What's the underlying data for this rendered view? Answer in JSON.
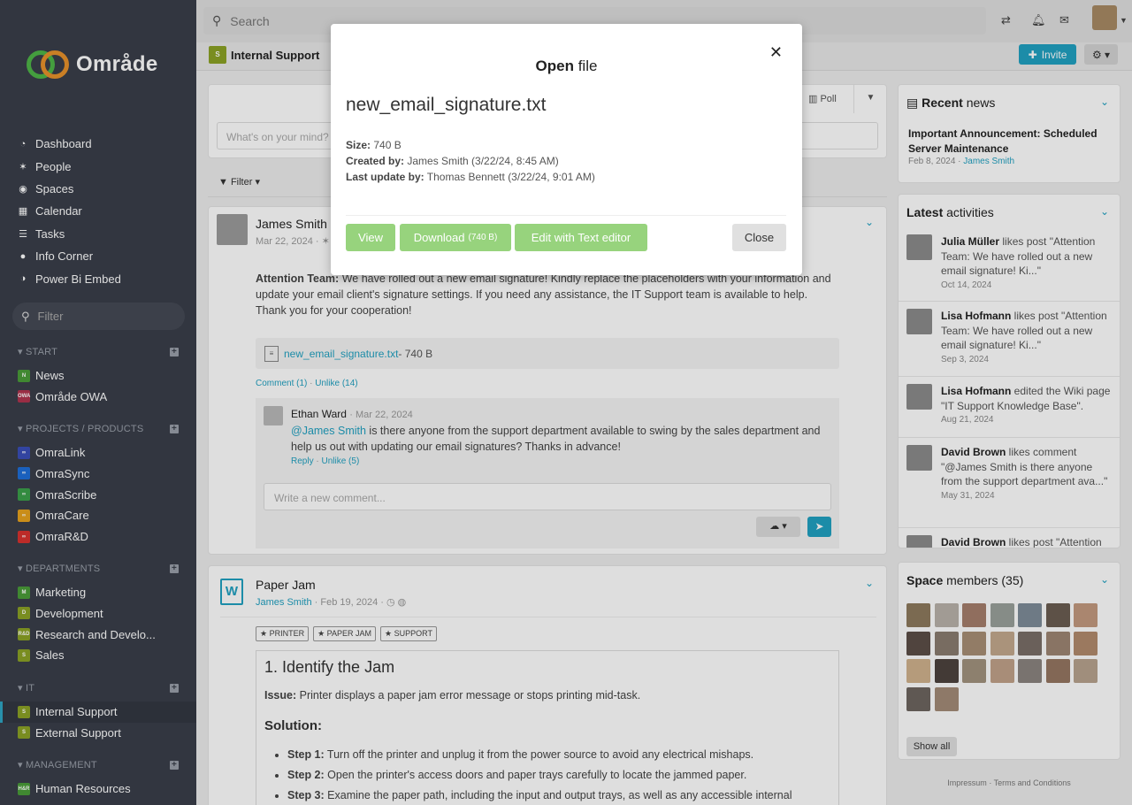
{
  "brand": {
    "name": "Område",
    "ring_green": "#4fb648",
    "ring_orange": "#e8922b"
  },
  "nav": [
    {
      "icon": "dashboard-icon",
      "glyph": "◔",
      "label": "Dashboard"
    },
    {
      "icon": "people-icon",
      "glyph": "✶",
      "label": "People"
    },
    {
      "icon": "spaces-icon",
      "glyph": "◉",
      "label": "Spaces"
    },
    {
      "icon": "calendar-icon",
      "glyph": "▦",
      "label": "Calendar"
    },
    {
      "icon": "tasks-icon",
      "glyph": "☰",
      "label": "Tasks"
    },
    {
      "icon": "info-corner-icon",
      "glyph": "●",
      "label": "Info Corner"
    },
    {
      "icon": "power-bi-icon",
      "glyph": "◑",
      "label": "Power Bi Embed"
    }
  ],
  "sidebar_filter": {
    "placeholder": "Filter"
  },
  "sections": [
    {
      "title": "START",
      "items": [
        {
          "label": "News",
          "abbr": "N",
          "color": "#4a9d39"
        },
        {
          "label": "Område OWA",
          "abbr": "OWA",
          "color": "#b0344f"
        }
      ]
    },
    {
      "title": "PROJECTS / PRODUCTS",
      "items": [
        {
          "label": "OmraLink",
          "abbr": "∞",
          "color": "#3a4fb8"
        },
        {
          "label": "OmraSync",
          "abbr": "∞",
          "color": "#1e6fd9"
        },
        {
          "label": "OmraScribe",
          "abbr": "∞",
          "color": "#3ba04a"
        },
        {
          "label": "OmraCare",
          "abbr": "∞",
          "color": "#e7a21d"
        },
        {
          "label": "OmraR&D",
          "abbr": "∞",
          "color": "#d8322e"
        }
      ]
    },
    {
      "title": "DEPARTMENTS",
      "items": [
        {
          "label": "Marketing",
          "abbr": "M",
          "color": "#4a9d39"
        },
        {
          "label": "Development",
          "abbr": "D",
          "color": "#8ba225"
        },
        {
          "label": "Research and Develo...",
          "abbr": "R&D",
          "color": "#8ba225"
        },
        {
          "label": "Sales",
          "abbr": "S",
          "color": "#8ba225"
        }
      ]
    },
    {
      "title": "IT",
      "items": [
        {
          "label": "Internal Support",
          "abbr": "S",
          "color": "#8ba225",
          "active": true
        },
        {
          "label": "External Support",
          "abbr": "S",
          "color": "#8ba225"
        }
      ]
    },
    {
      "title": "MANAGEMENT",
      "items": [
        {
          "label": "Human Resources",
          "abbr": "H&R",
          "color": "#4a9d39"
        }
      ]
    }
  ],
  "topbar": {
    "search_placeholder": "Search"
  },
  "space": {
    "title": "Internal Support",
    "abbr": "S",
    "invite_label": "Invite"
  },
  "composer": {
    "placeholder": "What's on your mind?",
    "poll_label": "Poll",
    "filter_label": "Filter"
  },
  "post1": {
    "author": "James Smith",
    "date": "Mar 22, 2024",
    "body_bold": "Attention Team:",
    "body": " We have rolled out a new email signature! Kindly replace the placeholders with your information and update your email client's signature settings. If you need any assistance, the IT Support team is available to help. Thank you for your cooperation!",
    "attachment_name": "new_email_signature.txt",
    "attachment_size": " - 740 B",
    "comment_link": "Comment (1)",
    "unlike_link": "Unlike (14)",
    "comment": {
      "author": "Ethan Ward",
      "date": "· Mar 22, 2024",
      "mention": "@James Smith",
      "text": " is there anyone from the support department available to swing by the sales department and help us out with updating our email signatures? Thanks in advance!",
      "reply": "Reply",
      "unlike": "Unlike (5)"
    },
    "new_comment_placeholder": "Write a new comment..."
  },
  "post2": {
    "title": "Paper Jam",
    "author": "James Smith",
    "date": "· Feb 19, 2024 ·",
    "tags": [
      "PRINTER",
      "PAPER JAM",
      "SUPPORT"
    ],
    "heading": "1. Identify the Jam",
    "issue_label": "Issue:",
    "issue": " Printer displays a paper jam error message or stops printing mid-task.",
    "solution": "Solution:",
    "steps": [
      {
        "label": "Step 1:",
        "text": " Turn off the printer and unplug it from the power source to avoid any electrical mishaps."
      },
      {
        "label": "Step 2:",
        "text": " Open the printer's access doors and paper trays carefully to locate the jammed paper."
      },
      {
        "label": "Step 3:",
        "text": " Examine the paper path, including the input and output trays, as well as any accessible internal"
      }
    ]
  },
  "recent_news": {
    "title_bold": "Recent",
    "title_rest": " news",
    "item_title": "Important Announcement: Scheduled Server Maintenance",
    "item_date": "Feb 8, 2024 · ",
    "item_author": "James Smith"
  },
  "latest_activities": {
    "title_bold": "Latest",
    "title_rest": " activities",
    "items": [
      {
        "name": "Julia Müller",
        "text": " likes post \"Attention Team: We have rolled out a new email signature! Ki...\"",
        "date": "Oct 14, 2024"
      },
      {
        "name": "Lisa Hofmann",
        "text": " likes post \"Attention Team: We have rolled out a new email signature! Ki...\"",
        "date": "Sep 3, 2024"
      },
      {
        "name": "Lisa Hofmann",
        "text": " edited the Wiki page \"IT Support Knowledge Base\".",
        "date": "Aug 21, 2024"
      },
      {
        "name": "David Brown",
        "text": " likes comment \"@James Smith is there anyone from the support department ava...\"",
        "date": "May 31, 2024"
      },
      {
        "name": "David Brown",
        "text": " likes post \"Attention",
        "date": ""
      }
    ]
  },
  "space_members": {
    "title_bold": "Space",
    "title_rest": " members (35)",
    "show_all": "Show all"
  },
  "footer": {
    "impressum": "Impressum",
    "terms": "Terms and Conditions"
  },
  "modal": {
    "title_bold": "Open",
    "title_rest": " file",
    "filename": "new_email_signature.txt",
    "size_label": "Size:",
    "size": " 740 B",
    "created_label": "Created by:",
    "created": " James Smith (3/22/24, 8:45 AM)",
    "updated_label": "Last update by:",
    "updated": " Thomas Bennett (3/22/24, 9:01 AM)",
    "view": "View",
    "download": "Download",
    "download_size": "(740 B)",
    "edit": "Edit with Text editor",
    "close": "Close"
  }
}
